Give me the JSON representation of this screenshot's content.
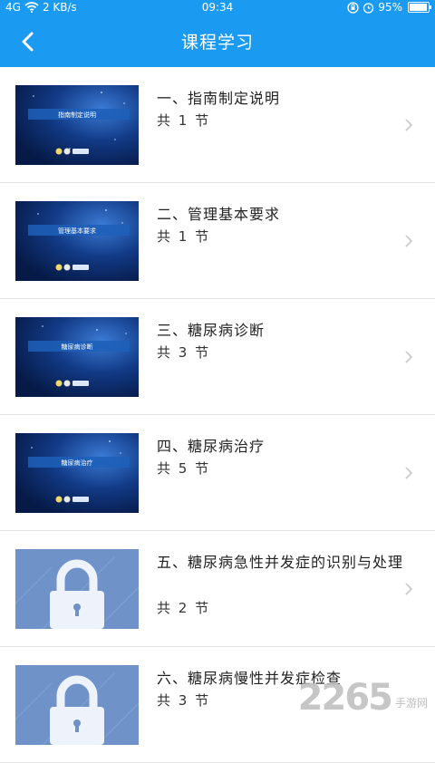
{
  "status_bar": {
    "signal": "4G",
    "speed": "2 KB/s",
    "time": "09:34",
    "battery": "95%"
  },
  "header": {
    "title": "课程学习"
  },
  "courses": [
    {
      "thumb_text": "指南制定说明",
      "title": "一、指南制定说明",
      "count": "共 1 节",
      "thumb_kind": "space"
    },
    {
      "thumb_text": "管理基本要求",
      "title": "二、管理基本要求",
      "count": "共 1 节",
      "thumb_kind": "space"
    },
    {
      "thumb_text": "糖尿病诊断",
      "title": "三、糖尿病诊断",
      "count": "共 3 节",
      "thumb_kind": "space"
    },
    {
      "thumb_text": "糖尿病治疗",
      "title": "四、糖尿病治疗",
      "count": "共 5 节",
      "thumb_kind": "space"
    },
    {
      "title": "五、糖尿病急性并发症的识别与处理",
      "count": "共 2 节",
      "thumb_kind": "locked"
    },
    {
      "title": "六、糖尿病慢性并发症检查",
      "count": "共 3 节",
      "thumb_kind": "locked"
    }
  ],
  "watermark": {
    "big": "2265",
    "small": "手游网"
  },
  "colors": {
    "primary": "#1a9af0",
    "divider": "#e6e6e6"
  },
  "icons": {
    "back": "chevron-left-icon",
    "chevron": "chevron-right-icon",
    "lock": "lock-icon"
  }
}
